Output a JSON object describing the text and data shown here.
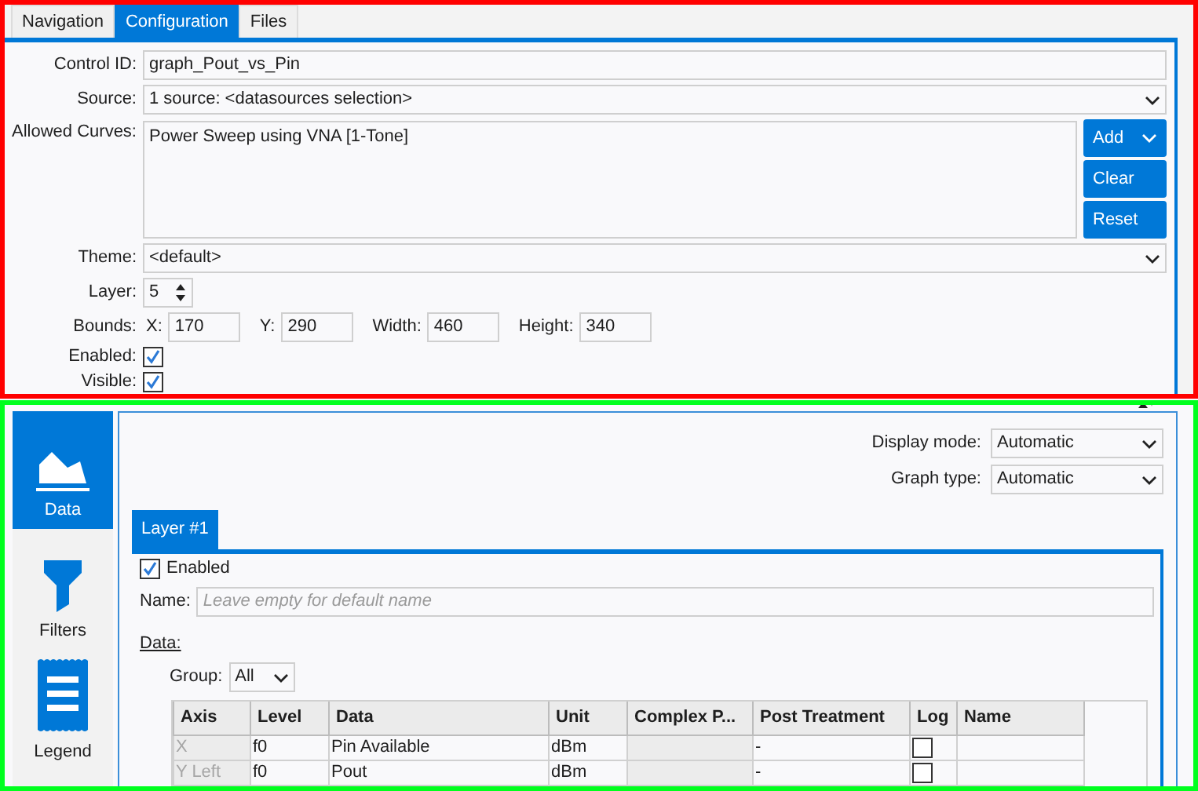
{
  "tabs": [
    {
      "label": "Navigation",
      "selected": false
    },
    {
      "label": "Configuration",
      "selected": true
    },
    {
      "label": "Files",
      "selected": false
    }
  ],
  "config": {
    "control_id": {
      "label": "Control ID:",
      "value": "graph_Pout_vs_Pin"
    },
    "source": {
      "label": "Source:",
      "value": "1 source: <datasources selection>"
    },
    "allowed_curves": {
      "label": "Allowed Curves:",
      "items": [
        "Power Sweep using VNA [1-Tone]"
      ],
      "buttons": [
        {
          "label": "Add",
          "kind": "dropdown"
        },
        {
          "label": "Clear",
          "kind": "plain"
        },
        {
          "label": "Reset",
          "kind": "plain"
        }
      ]
    },
    "theme": {
      "label": "Theme:",
      "value": "<default>"
    },
    "layer": {
      "label": "Layer:",
      "value": "5"
    },
    "bounds": {
      "label": "Bounds:",
      "fields": [
        {
          "label": "X:",
          "value": "170"
        },
        {
          "label": "Y:",
          "value": "290"
        },
        {
          "label": "Width:",
          "value": "460"
        },
        {
          "label": "Height:",
          "value": "340"
        }
      ]
    },
    "enabled": {
      "label": "Enabled:",
      "checked": true
    },
    "visible": {
      "label": "Visible:",
      "checked": true
    }
  },
  "sidebar": {
    "items": [
      {
        "label": "Data",
        "kind": "chart",
        "selected": true
      },
      {
        "label": "Filters",
        "kind": "filter",
        "selected": false
      },
      {
        "label": "Legend",
        "kind": "legend",
        "selected": false
      }
    ]
  },
  "display_mode": {
    "label": "Display mode:",
    "value": "Automatic"
  },
  "graph_type": {
    "label": "Graph type:",
    "value": "Automatic"
  },
  "layer_tabs": [
    {
      "label": "Layer #1",
      "selected": true
    }
  ],
  "layer": {
    "enabled": {
      "label": "Enabled",
      "checked": true
    },
    "name": {
      "label": "Name:",
      "placeholder": "Leave empty for default name"
    },
    "data_heading": "Data:",
    "group": {
      "label": "Group:",
      "value": "All"
    },
    "table": {
      "columns": [
        "Axis",
        "Level",
        "Data",
        "Unit",
        "Complex P...",
        "Post Treatment",
        "Log",
        "Name"
      ],
      "rows": [
        {
          "axis": "X",
          "level": "f0",
          "data": "Pin Available",
          "unit": "dBm",
          "post_treatment": "-",
          "log": false
        },
        {
          "axis": "Y Left",
          "level": "f0",
          "data": "Pout",
          "unit": "dBm",
          "post_treatment": "-",
          "log": false
        }
      ]
    }
  }
}
